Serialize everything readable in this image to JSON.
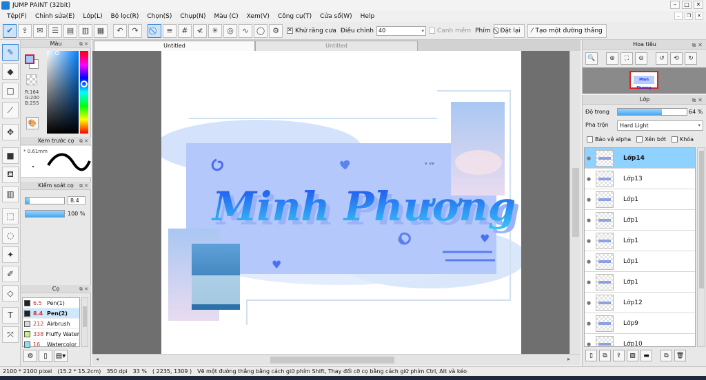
{
  "window": {
    "title": "JUMP PAINT (32bit)",
    "controls": [
      "–",
      "□",
      "✕"
    ]
  },
  "menu": [
    "Tệp(F)",
    "Chỉnh sửa(E)",
    "Lớp(L)",
    "Bộ lọc(R)",
    "Chọn(S)",
    "Chụp(N)",
    "Màu (C)",
    "Xem(V)",
    "Công cụ(T)",
    "Cửa sổ(W)",
    "Help"
  ],
  "toolbar": {
    "antialias_label": "Khử răng cưa",
    "antialias_checked": true,
    "adjust_label": "Điều chỉnh",
    "adjust_value": "40",
    "smooth_label": "Canh mềm",
    "key_label": "Phím",
    "reset_label": "Đặt lại",
    "straight_line_label": "Tạo một đường thẳng"
  },
  "panels": {
    "color": {
      "title": "Màu",
      "r": "R:164",
      "g": "G:200",
      "b": "B:255",
      "primary_color": "#a4c8ff"
    },
    "brush_preview": {
      "title": "Xem trước cọ",
      "size": "* 0.61mm"
    },
    "brush_control": {
      "title": "Kiểm soát cọ",
      "size_value": "8.4",
      "size_fraction": 0.1,
      "opacity": "100 %",
      "opacity_fraction": 1.0
    },
    "brushes": {
      "title": "Cọ",
      "items": [
        {
          "size": "6.5",
          "name": "Pen(1)",
          "color": "#222222"
        },
        {
          "size": "8.4",
          "name": "Pen(2)",
          "color": "#222222",
          "selected": true
        },
        {
          "size": "212",
          "name": "Airbrush",
          "color": "#d8d8d8"
        },
        {
          "size": "338",
          "name": "Fluffy Water",
          "color": "#c8f08a"
        },
        {
          "size": "16",
          "name": "Watercolor",
          "color": "#8fdcf5"
        }
      ]
    }
  },
  "tabs": {
    "active": "Untitled",
    "inactive": "Untitled"
  },
  "artwork": {
    "text": "Minh Phương",
    "accent": "#1c38e8",
    "band": "#b4c8fb"
  },
  "navigator": {
    "title": "Hoa tiêu",
    "thumb_text": "Minh Phương"
  },
  "layers": {
    "title": "Lớp",
    "opacity_label": "Độ trong",
    "opacity_value": "64 %",
    "opacity_fraction": 0.64,
    "blend_label": "Pha trộn",
    "blend_mode": "Hard Light",
    "protect_alpha": "Bảo vệ alpha",
    "clip": "Xén bớt",
    "lock": "Khóa",
    "items": [
      {
        "name": "Lớp14",
        "selected": true
      },
      {
        "name": "Lớp13"
      },
      {
        "name": "Lớp1"
      },
      {
        "name": "Lớp1"
      },
      {
        "name": "Lớp1"
      },
      {
        "name": "Lớp1"
      },
      {
        "name": "Lớp1"
      },
      {
        "name": "Lớp12"
      },
      {
        "name": "Lớp9"
      },
      {
        "name": "Lớp10"
      }
    ]
  },
  "status": {
    "canvas_size": "2100 * 2100 pixel",
    "physical_size": "(15.2 * 15.2cm)",
    "dpi": "350 dpi",
    "zoom": "33 %",
    "cursor": "( 2235, 1309 )",
    "hint": "Vẽ một đường thẳng bằng cách giữ phím Shift, Thay đổi cỡ cọ bằng cách giữ phím Ctrl, Alt và kéo"
  }
}
